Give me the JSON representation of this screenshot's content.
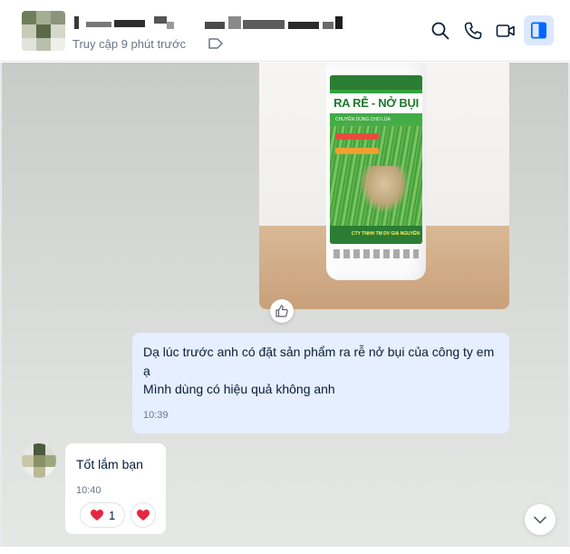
{
  "header": {
    "contact_name": "",
    "status": "Truy cập 9 phút trước",
    "icons": [
      "search-icon",
      "phone-icon",
      "video-call-icon",
      "side-panel-icon"
    ],
    "accent_color": "#0068ff"
  },
  "photo": {
    "product_title": "RA RỄ - NỞ BỤI",
    "product_subtitle": "CHUYÊN DÙNG CHO LÚA",
    "company": "CTY TNHH TM DV GIA NGUYÊN"
  },
  "messages": {
    "outgoing": {
      "line1": "Dạ lúc trước anh có đặt sản phẩm ra rễ nở bụi của công ty em ạ",
      "line2": "Mình dùng có hiệu quả không anh",
      "time": "10:39",
      "bubble_color": "#e5efff"
    },
    "incoming": {
      "text": "Tốt lắm bạn",
      "time": "10:40",
      "reaction_count": "1",
      "reaction_icon": "heart-icon"
    }
  }
}
